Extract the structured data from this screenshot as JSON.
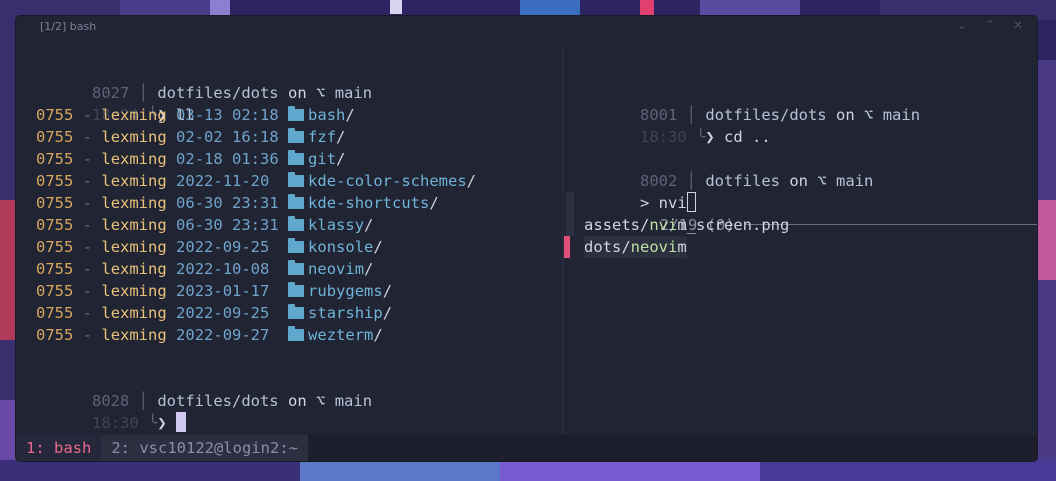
{
  "window": {
    "title": "[1/2] bash",
    "controls": [
      "⌄",
      "⌃",
      "✕"
    ]
  },
  "left_pane": {
    "prompt1": {
      "num": "8027",
      "time": "18:24",
      "path": "dotfiles/dots",
      "on": "on",
      "branch_symbol": "⌥",
      "branch": "main",
      "command": "❯ ll"
    },
    "listing": [
      {
        "perm": "0755",
        "dash": "-",
        "user": "lexming",
        "date": "03-13 02:18",
        "name": "bash"
      },
      {
        "perm": "0755",
        "dash": "-",
        "user": "lexming",
        "date": "02-02 16:18",
        "name": "fzf"
      },
      {
        "perm": "0755",
        "dash": "-",
        "user": "lexming",
        "date": "02-18 01:36",
        "name": "git"
      },
      {
        "perm": "0755",
        "dash": "-",
        "user": "lexming",
        "date": "2022-11-20",
        "name": "kde-color-schemes"
      },
      {
        "perm": "0755",
        "dash": "-",
        "user": "lexming",
        "date": "06-30 23:31",
        "name": "kde-shortcuts"
      },
      {
        "perm": "0755",
        "dash": "-",
        "user": "lexming",
        "date": "06-30 23:31",
        "name": "klassy"
      },
      {
        "perm": "0755",
        "dash": "-",
        "user": "lexming",
        "date": "2022-09-25",
        "name": "konsole"
      },
      {
        "perm": "0755",
        "dash": "-",
        "user": "lexming",
        "date": "2022-10-08",
        "name": "neovim"
      },
      {
        "perm": "0755",
        "dash": "-",
        "user": "lexming",
        "date": "2023-01-17",
        "name": "rubygems"
      },
      {
        "perm": "0755",
        "dash": "-",
        "user": "lexming",
        "date": "2022-09-25",
        "name": "starship"
      },
      {
        "perm": "0755",
        "dash": "-",
        "user": "lexming",
        "date": "2022-09-27",
        "name": "wezterm"
      }
    ],
    "slash": "/",
    "prompt2": {
      "num": "8028",
      "time": "18:30",
      "path": "dotfiles/dots",
      "on": "on",
      "branch_symbol": "⌥",
      "branch": "main",
      "command": "❯ "
    }
  },
  "right_pane": {
    "prompt1": {
      "num": "8001",
      "time": "18:30",
      "path": "dotfiles/dots",
      "on": "on",
      "branch_symbol": "⌥",
      "branch": "main",
      "command": "❯ cd .."
    },
    "prompt2": {
      "num": "8002",
      "path": "dotfiles",
      "on": "on",
      "branch_symbol": "⌥",
      "branch": "main"
    },
    "fzf": {
      "query_prefix": "> ",
      "query": "nvi",
      "count": "2/19 (0)",
      "results": [
        {
          "pre": "assets/",
          "match": "nvi",
          "post": "m_screen.png",
          "selected": false
        },
        {
          "pre": "dots/",
          "match": "neovi",
          "post": "m",
          "selected": true
        }
      ]
    }
  },
  "statusbar": {
    "tabs": [
      {
        "label": "1: bash",
        "active": true
      },
      {
        "label": "2: vsc10122@login2:~",
        "active": false
      }
    ]
  },
  "colors": {
    "accent": "#e86a8a",
    "folder": "#5fa9cf",
    "user": "#e8c17a",
    "date": "#6fa3cc"
  }
}
